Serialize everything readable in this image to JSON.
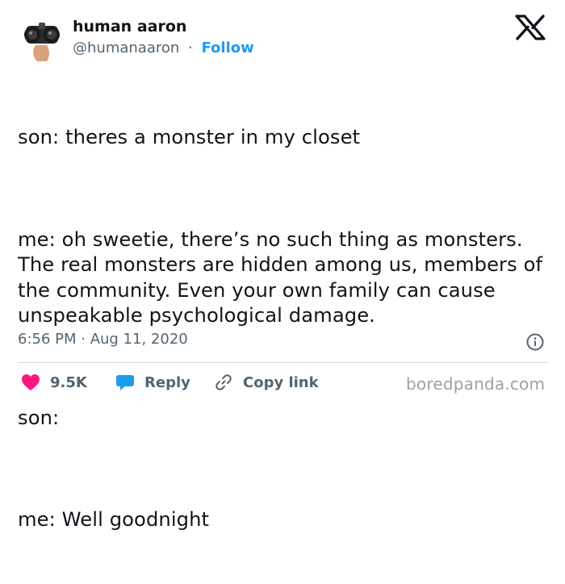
{
  "author": {
    "display_name": "human aaron",
    "handle": "@humanaaron",
    "separator": "·",
    "follow_label": "Follow"
  },
  "tweet": {
    "lines": [
      "son: theres a monster in my closet",
      "me: oh sweetie, there’s no such thing as monsters. The real monsters are hidden among us, members of the community. Even your own family can cause unspeakable psychological damage.",
      "son:",
      "me: Well goodnight"
    ],
    "timestamp": "6:56 PM · Aug 11, 2020"
  },
  "actions": {
    "like_count": "9.5K",
    "reply_label": "Reply",
    "copy_link_label": "Copy link"
  },
  "watermark": "boredpanda.com",
  "icons": {
    "brand": "x-logo-icon",
    "like": "heart-icon",
    "reply": "speech-bubble-icon",
    "copy": "link-icon",
    "info": "info-icon"
  },
  "colors": {
    "text": "#0f1419",
    "secondary": "#536471",
    "follow": "#1d9bf0",
    "like": "#f91880",
    "reply": "#1d9bf0",
    "divider": "#cfd9de",
    "watermark": "#9aa2a8"
  }
}
